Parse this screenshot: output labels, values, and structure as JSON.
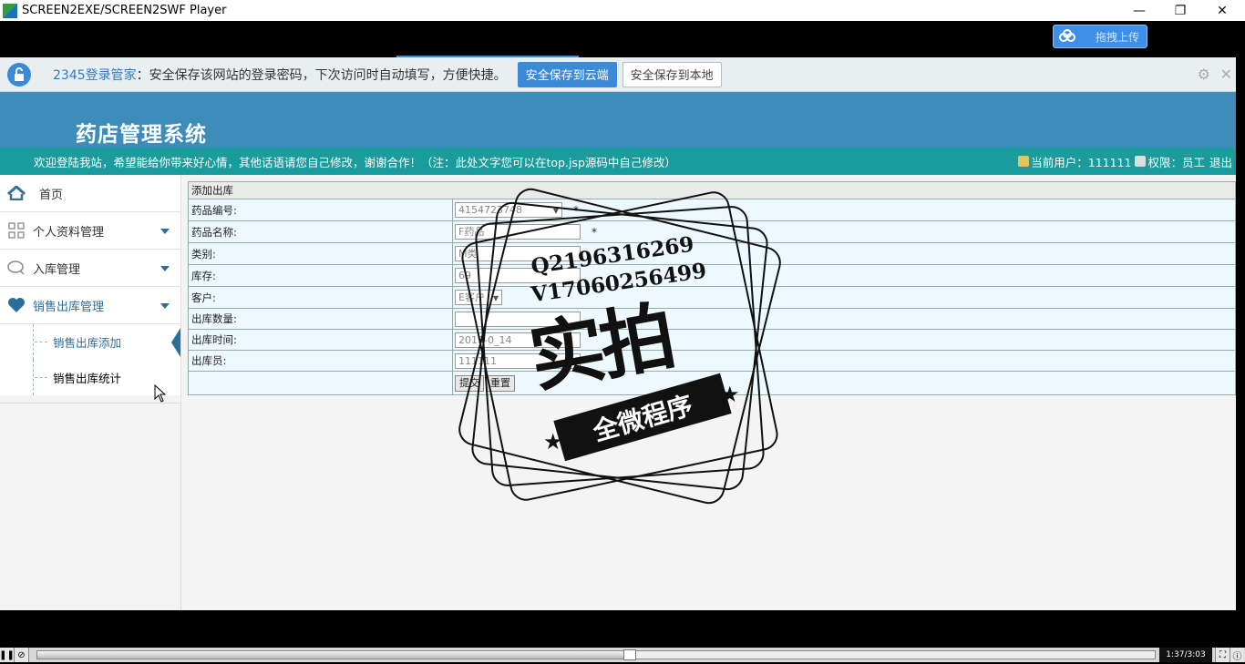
{
  "window": {
    "title": "SCREEN2EXE/SCREEN2SWF Player",
    "minimize": "—",
    "restore": "❐",
    "close": "✕"
  },
  "upload": {
    "label": "拖拽上传"
  },
  "password_bar": {
    "brand": "2345登录管家",
    "message": "：安全保存该网站的登录密码，下次访问时自动填写，方便快捷。",
    "save_cloud": "安全保存到云端",
    "save_local": "安全保存到本地",
    "settings_icon": "⚙",
    "close_icon": "✕"
  },
  "header": {
    "title": "药店管理系统"
  },
  "marquee": {
    "welcome": "欢迎登陆我站，希望能给你带来好心情，其他话语请您自己修改，谢谢合作！（注：此处文字您可以在top.jsp源码中自己修改）",
    "current_user": "当前用户：111111",
    "permission": "权限：员工",
    "logout": "退出"
  },
  "sidebar": {
    "items": [
      {
        "label": "首页",
        "icon": "home-icon"
      },
      {
        "label": "个人资料管理",
        "icon": "grid-icon"
      },
      {
        "label": "入库管理",
        "icon": "chat-icon"
      },
      {
        "label": "销售出库管理",
        "icon": "heart-icon"
      }
    ],
    "sub_items": [
      {
        "label": "销售出库添加"
      },
      {
        "label": "销售出库统计"
      }
    ]
  },
  "form": {
    "caption": "添加出库",
    "rows": [
      {
        "label": "药品编号:",
        "value": "4154723748"
      },
      {
        "label": "药品名称:",
        "value": "F药品"
      },
      {
        "label": "类别:",
        "value": "M类"
      },
      {
        "label": "库存:",
        "value": "69"
      },
      {
        "label": "客户:",
        "value": "E客户"
      },
      {
        "label": "出库数量:",
        "value": ""
      },
      {
        "label": "出库时间:",
        "value": "2019-0_14"
      },
      {
        "label": "出库员:",
        "value": "111111"
      }
    ],
    "required": "*",
    "submit": "提交",
    "reset": "重置"
  },
  "watermark": {
    "line1": "Q2196316269",
    "line2": "V17060256499",
    "big": "实拍",
    "ribbon": "全微程序"
  },
  "player": {
    "time": "1:37/3:03",
    "progress": 0.53
  }
}
